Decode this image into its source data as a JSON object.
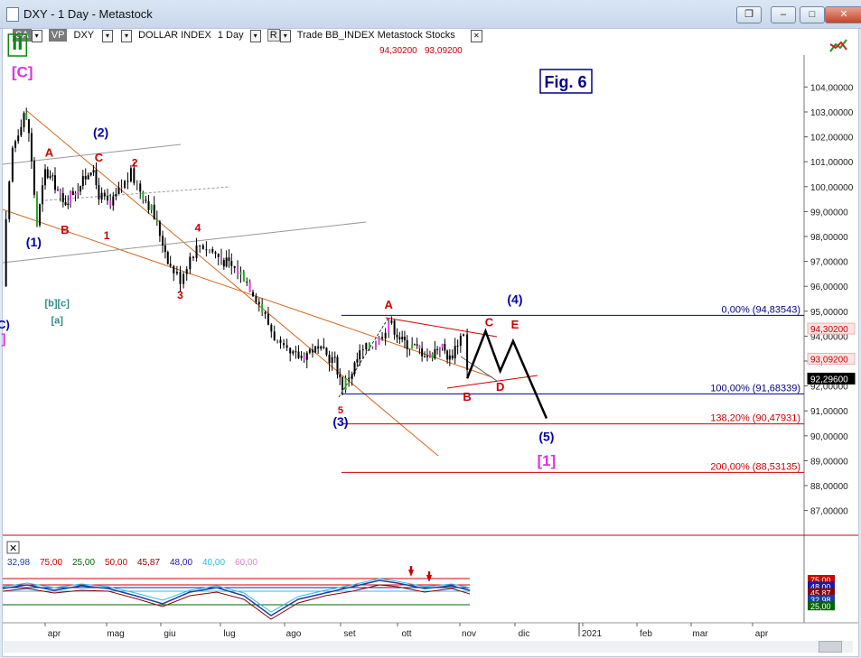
{
  "window": {
    "title": "DXY - 1 Day - Metastock",
    "controls": [
      "restore-down",
      "minimize",
      "maximize",
      "close"
    ]
  },
  "toolbar": {
    "sa": "SA",
    "vp": "VP",
    "symbol": "DXY",
    "security_name": "DOLLAR INDEX",
    "period": "1 Day",
    "right_text": "Trade  BB_INDEX  Metastock  Stocks",
    "r_button": "R"
  },
  "header_prices": {
    "high": "94,30200",
    "low": "93,09200"
  },
  "fig_label": "Fig. 6",
  "indicator_legend": [
    {
      "text": "32,98",
      "color": "#1a3fa0"
    },
    {
      "text": "75,00",
      "color": "#cc0000"
    },
    {
      "text": "25,00",
      "color": "#006600"
    },
    {
      "text": "50,00",
      "color": "#cc0000"
    },
    {
      "text": "45,87",
      "color": "#8b0000"
    },
    {
      "text": "48,00",
      "color": "#1a1aa8"
    },
    {
      "text": "40,00",
      "color": "#33b8e8"
    },
    {
      "text": "60,00",
      "color": "#e07fe0"
    }
  ],
  "indicator_badges": [
    {
      "text": "75,00",
      "color": "#cc0000"
    },
    {
      "text": "48,00",
      "color": "#1a1aa8"
    },
    {
      "text": "45,87",
      "color": "#8b0000"
    },
    {
      "text": "32,98",
      "color": "#1a3fa0"
    },
    {
      "text": "25,00",
      "color": "#006600"
    }
  ],
  "chart_data": {
    "type": "candlestick",
    "y_ticks": [
      "104,00000",
      "103,00000",
      "102,00000",
      "101,00000",
      "100,00000",
      "99,00000",
      "98,00000",
      "97,00000",
      "96,00000",
      "95,00000",
      "94,00000",
      "93,00000",
      "92,00000",
      "91,00000",
      "90,00000",
      "89,00000",
      "88,00000",
      "87,00000"
    ],
    "x_ticks": [
      "apr",
      "mag",
      "giu",
      "lug",
      "ago",
      "set",
      "ott",
      "nov",
      "dic",
      "2021",
      "feb",
      "mar",
      "apr"
    ],
    "ylim": [
      86.5,
      104.6
    ],
    "price_badges": [
      {
        "text": "94,30200",
        "value": 94.302,
        "color": "#cc0000",
        "fill": "#fde3e3"
      },
      {
        "text": "93,09200",
        "value": 93.092,
        "color": "#cc0000",
        "fill": "#fde3e3"
      },
      {
        "text": "92,29600",
        "value": 92.296,
        "color": "#ffffff",
        "fill": "#000000"
      }
    ],
    "fib_levels": [
      {
        "label": "0,00% (94,83543)",
        "value": 94.83543,
        "color": "#00008b"
      },
      {
        "label": "100,00% (91,68339)",
        "value": 91.68339,
        "color": "#00008b"
      },
      {
        "label": "138,20% (90,47931)",
        "value": 90.47931,
        "color": "#cc0000"
      },
      {
        "label": "200,00% (88,53135)",
        "value": 88.53135,
        "color": "#cc0000"
      }
    ],
    "price_path": [
      [
        "feb-end",
        96.0
      ],
      [
        "mar-08",
        98.5
      ],
      [
        "mar-12",
        101.5
      ],
      [
        "mar-19",
        103.0
      ],
      [
        "mar-22",
        102.2
      ],
      [
        "mar-27",
        98.5
      ],
      [
        "apr-01",
        100.6
      ],
      [
        "apr-06",
        100.1
      ],
      [
        "apr-10",
        99.3
      ],
      [
        "apr-15",
        99.8
      ],
      [
        "apr-20",
        100.2
      ],
      [
        "apr-24",
        100.8
      ],
      [
        "apr-28",
        99.7
      ],
      [
        "may-04",
        99.2
      ],
      [
        "may-10",
        100.0
      ],
      [
        "may-15",
        100.5
      ],
      [
        "may-20",
        99.9
      ],
      [
        "may-26",
        99.1
      ],
      [
        "jun-01",
        97.8
      ],
      [
        "jun-05",
        96.8
      ],
      [
        "jun-10",
        96.3
      ],
      [
        "jun-15",
        97.2
      ],
      [
        "jun-20",
        97.7
      ],
      [
        "jun-25",
        97.5
      ],
      [
        "jul-01",
        97.1
      ],
      [
        "jul-06",
        96.8
      ],
      [
        "jul-12",
        96.4
      ],
      [
        "jul-18",
        95.6
      ],
      [
        "jul-24",
        94.5
      ],
      [
        "jul-30",
        93.5
      ],
      [
        "aug-04",
        93.2
      ],
      [
        "aug-10",
        93.2
      ],
      [
        "aug-16",
        93.5
      ],
      [
        "aug-22",
        93.3
      ],
      [
        "aug-28",
        93.0
      ],
      [
        "sep-01",
        92.0
      ],
      [
        "sep-06",
        92.6
      ],
      [
        "sep-10",
        93.3
      ],
      [
        "sep-15",
        93.6
      ],
      [
        "sep-20",
        93.9
      ],
      [
        "sep-25",
        94.6
      ],
      [
        "sep-28",
        94.3
      ],
      [
        "oct-02",
        93.8
      ],
      [
        "oct-07",
        93.6
      ],
      [
        "oct-12",
        93.4
      ],
      [
        "oct-16",
        93.2
      ],
      [
        "oct-21",
        93.7
      ],
      [
        "oct-26",
        93.1
      ],
      [
        "oct-30",
        93.8
      ],
      [
        "nov-02",
        94.2
      ],
      [
        "nov-04",
        92.6
      ]
    ],
    "projection_path": [
      [
        "nov-04",
        92.3
      ],
      [
        "nov-14",
        94.2
      ],
      [
        "nov-22",
        92.6
      ],
      [
        "nov-29",
        93.8
      ],
      [
        "dic-16",
        90.7
      ]
    ],
    "wave_labels": [
      {
        "text": "[C]",
        "x": "mar-18",
        "y": 104.4,
        "color": "#dd33dd",
        "size": 17
      },
      {
        "text": "(2)",
        "x": "apr-29",
        "y": 102.0,
        "color": "#0000aa",
        "size": 14
      },
      {
        "text": "A",
        "x": "apr-03",
        "y": 101.2,
        "color": "#cc0000",
        "size": 13
      },
      {
        "text": "C",
        "x": "apr-28",
        "y": 101.0,
        "color": "#cc0000",
        "size": 13
      },
      {
        "text": "2",
        "x": "may-17",
        "y": 100.8,
        "color": "#cc0000",
        "size": 12
      },
      {
        "text": "(1)",
        "x": "mar-25",
        "y": 97.6,
        "color": "#0000aa",
        "size": 14
      },
      {
        "text": "B",
        "x": "apr-11",
        "y": 98.1,
        "color": "#cc0000",
        "size": 13
      },
      {
        "text": "1",
        "x": "may-02",
        "y": 97.9,
        "color": "#cc0000",
        "size": 12
      },
      {
        "text": "4",
        "x": "jun-19",
        "y": 98.2,
        "color": "#cc0000",
        "size": 12
      },
      {
        "text": "3",
        "x": "jun-10",
        "y": 95.5,
        "color": "#cc0000",
        "size": 12
      },
      {
        "text": "A",
        "x": "sep-25",
        "y": 95.1,
        "color": "#cc0000",
        "size": 13
      },
      {
        "text": "C",
        "x": "nov-16",
        "y": 94.4,
        "color": "#cc0000",
        "size": 13
      },
      {
        "text": "E",
        "x": "nov-30",
        "y": 94.3,
        "color": "#cc0000",
        "size": 13
      },
      {
        "text": "(4)",
        "x": "nov-30",
        "y": 95.3,
        "color": "#0000aa",
        "size": 14
      },
      {
        "text": "B",
        "x": "nov-04",
        "y": 91.4,
        "color": "#cc0000",
        "size": 13
      },
      {
        "text": "D",
        "x": "nov-22",
        "y": 91.8,
        "color": "#cc0000",
        "size": 13
      },
      {
        "text": "5",
        "x": "aug-31",
        "y": 90.9,
        "color": "#cc0000",
        "size": 11
      },
      {
        "text": "(3)",
        "x": "aug-31",
        "y": 90.4,
        "color": "#0000aa",
        "size": 14
      },
      {
        "text": "(5)",
        "x": "dic-16",
        "y": 89.8,
        "color": "#0000aa",
        "size": 14
      },
      {
        "text": "[1]",
        "x": "dic-16",
        "y": 88.8,
        "color": "#dd33dd",
        "size": 17
      },
      {
        "text": "[b][c]",
        "x": "apr-07",
        "y": 95.2,
        "color": "#2a8a8a",
        "size": 11
      },
      {
        "text": "[a]",
        "x": "apr-07",
        "y": 94.5,
        "color": "#2a8a8a",
        "size": 11
      },
      {
        "text": "II",
        "x": "mar-15",
        "y": 105.5,
        "color": "#0a8a0a",
        "size": 22
      },
      {
        "text": "C)",
        "x": "feb-end",
        "y": 94.3,
        "color": "#0000aa",
        "size": 13
      },
      {
        "text": "]",
        "x": "feb-end",
        "y": 93.7,
        "color": "#dd33dd",
        "size": 15
      }
    ]
  }
}
